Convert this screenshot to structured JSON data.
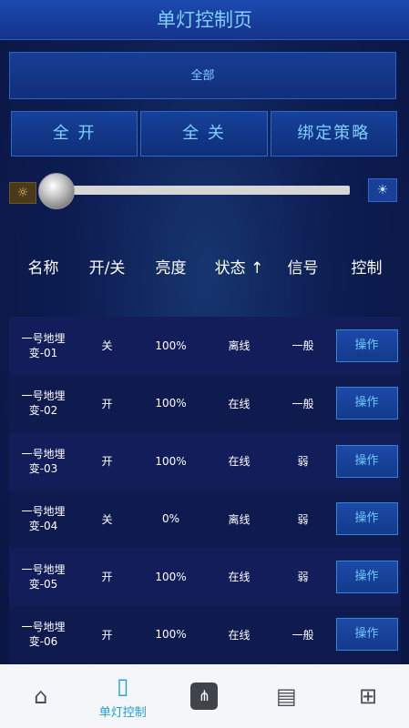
{
  "header": {
    "title": "单灯控制页"
  },
  "group_selector": {
    "label": "全部"
  },
  "actions": {
    "all_on": "全 开",
    "all_off": "全 关",
    "bind_policy": "绑定策略"
  },
  "brightness": {
    "value_percent": 0,
    "dim_icon": "sun-dim-icon",
    "bright_icon": "sun-bright-icon"
  },
  "table": {
    "headers": {
      "name": "名称",
      "switch": "开/关",
      "brightness": "亮度",
      "status": "状态 ↑",
      "signal": "信号",
      "control": "控制"
    },
    "rows": [
      {
        "name_line1": "一号地埋",
        "name_line2": "变-01",
        "switch": "关",
        "brightness": "100%",
        "status": "离线",
        "signal": "一般",
        "action": "操作"
      },
      {
        "name_line1": "一号地埋",
        "name_line2": "变-02",
        "switch": "开",
        "brightness": "100%",
        "status": "在线",
        "signal": "一般",
        "action": "操作"
      },
      {
        "name_line1": "一号地埋",
        "name_line2": "变-03",
        "switch": "开",
        "brightness": "100%",
        "status": "在线",
        "signal": "弱",
        "action": "操作"
      },
      {
        "name_line1": "一号地埋",
        "name_line2": "变-04",
        "switch": "关",
        "brightness": "0%",
        "status": "离线",
        "signal": "弱",
        "action": "操作"
      },
      {
        "name_line1": "一号地埋",
        "name_line2": "变-05",
        "switch": "开",
        "brightness": "100%",
        "status": "在线",
        "signal": "弱",
        "action": "操作"
      },
      {
        "name_line1": "一号地埋",
        "name_line2": "变-06",
        "switch": "开",
        "brightness": "100%",
        "status": "在线",
        "signal": "一般",
        "action": "操作"
      }
    ]
  },
  "navbar": {
    "items": [
      {
        "icon": "home-icon",
        "label": ""
      },
      {
        "icon": "light-control-icon",
        "label": "单灯控制"
      },
      {
        "icon": "network-device-icon",
        "label": ""
      },
      {
        "icon": "report-icon",
        "label": ""
      },
      {
        "icon": "topology-icon",
        "label": ""
      }
    ]
  },
  "colors": {
    "accent": "#7fd0ff",
    "background": "#0b1640",
    "nav_active": "#1f9ecf"
  }
}
